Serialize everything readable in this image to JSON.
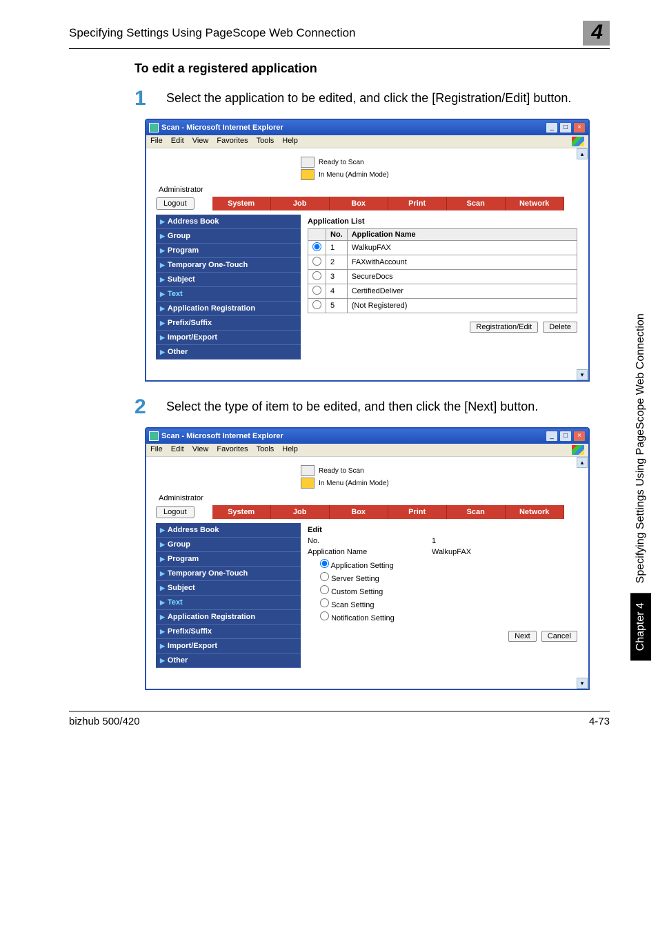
{
  "header": {
    "title": "Specifying Settings Using PageScope Web Connection",
    "chapter_number": "4"
  },
  "section": {
    "title": "To edit a registered application"
  },
  "steps": {
    "1": {
      "num": "1",
      "text": "Select the application to be edited, and click the [Registration/Edit] button."
    },
    "2": {
      "num": "2",
      "text": "Select the type of item to be edited, and then click the [Next] button."
    }
  },
  "window": {
    "title": "Scan - Microsoft Internet Explorer",
    "menus": [
      "File",
      "Edit",
      "View",
      "Favorites",
      "Tools",
      "Help"
    ],
    "status1": "Ready to Scan",
    "status2": "In Menu (Admin Mode)",
    "admin_label": "Administrator",
    "logout": "Logout",
    "tabs": [
      "System",
      "Job",
      "Box",
      "Print",
      "Scan",
      "Network"
    ],
    "sidebar": [
      "Address Book",
      "Group",
      "Program",
      "Temporary One-Touch",
      "Subject",
      "Text",
      "Application Registration",
      "Prefix/Suffix",
      "Import/Export",
      "Other"
    ]
  },
  "screen1": {
    "list_title": "Application List",
    "col_no": "No.",
    "col_name": "Application Name",
    "rows": [
      {
        "no": "1",
        "name": "WalkupFAX"
      },
      {
        "no": "2",
        "name": "FAXwithAccount"
      },
      {
        "no": "3",
        "name": "SecureDocs"
      },
      {
        "no": "4",
        "name": "CertifiedDeliver"
      },
      {
        "no": "5",
        "name": "(Not Registered)"
      }
    ],
    "reg_edit_btn": "Registration/Edit",
    "delete_btn": "Delete"
  },
  "screen2": {
    "edit_title": "Edit",
    "no_label": "No.",
    "no_value": "1",
    "appname_label": "Application Name",
    "appname_value": "WalkupFAX",
    "radios": [
      "Application Setting",
      "Server Setting",
      "Custom Setting",
      "Scan Setting",
      "Notification Setting"
    ],
    "next_btn": "Next",
    "cancel_btn": "Cancel"
  },
  "side_tab": {
    "black": "Chapter 4",
    "gray": "Specifying Settings Using PageScope Web Connection"
  },
  "footer": {
    "left": "bizhub 500/420",
    "right": "4-73"
  }
}
